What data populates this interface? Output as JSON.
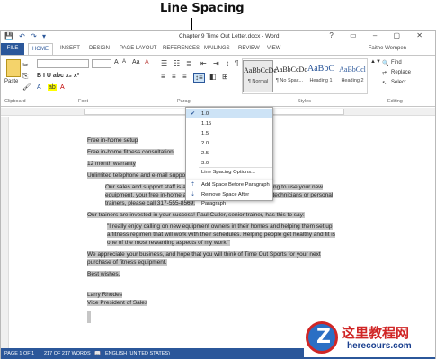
{
  "callout": {
    "text": "Line Spacing"
  },
  "window": {
    "title": "Chapter 9 Time Out Letter.docx - Word",
    "controls": "? ▭ – ▢ ✕",
    "qat": "💾 ↶ ↷ ▾"
  },
  "tabs": [
    "FILE",
    "HOME",
    "INSERT",
    "DESIGN",
    "PAGE LAYOUT",
    "REFERENCES",
    "MAILINGS",
    "REVIEW",
    "VIEW"
  ],
  "user": "Faithe Wempen",
  "ribbon": {
    "paste": "Paste",
    "clipboard": "Clipboard",
    "font": "Font",
    "paragraph": "Parag",
    "styles_label": "Styles",
    "editing_label": "Editing",
    "find": "Find",
    "replace": "Replace",
    "select": "Select",
    "font_buttons": "B I U abc x₂ x²",
    "styles": [
      {
        "sample": "AaBbCcDc",
        "label": "¶ Normal"
      },
      {
        "sample": "AaBbCcDc",
        "label": "¶ No Spac..."
      },
      {
        "sample": "AaBbC",
        "label": "Heading 1"
      },
      {
        "sample": "AaBbCcl",
        "label": "Heading 2"
      }
    ]
  },
  "line_spacing_menu": {
    "options": [
      "1.0",
      "1.15",
      "1.5",
      "2.0",
      "2.5",
      "3.0"
    ],
    "selected": "1.0",
    "more": "Line Spacing Options...",
    "add_before": "Add Space Before Paragraph",
    "remove_after": "Remove Space After Paragraph"
  },
  "document": {
    "lines": [
      "Free in-home setup",
      "Free in-home fitness consultation",
      "12 month warranty",
      "Unlimited telephone and e-mail suppor",
      "Our sales and support staff is                                        ance to you in setting up and learning to use your new equipment.                                  your free in-home appointment with one of our setup technicians or personal trainers, please call 317-555-8569.",
      "Our trainers are invested in your success!   Paul Cutler, senior trainer, has this to say:",
      "\"I really enjoy calling on new equipment owners in their homes and helping them set up a fitness regimen that will work with their schedules. Helping people get healthy and fit is one of the most rewarding aspects of my work.\"",
      "We appreciate your business, and hope that you will think of Time Out Sports for your next purchase of fitness equipment.",
      "Best wishes,",
      "Larry Rhodes",
      "Vice President of Sales"
    ]
  },
  "status": {
    "page": "PAGE 1 OF 1",
    "words": "217 OF 217 WORDS",
    "language": "ENGLISH (UNITED STATES)"
  },
  "watermark": {
    "cn": "这里教程网",
    "url": "herecours.com",
    "logo": "Z"
  }
}
